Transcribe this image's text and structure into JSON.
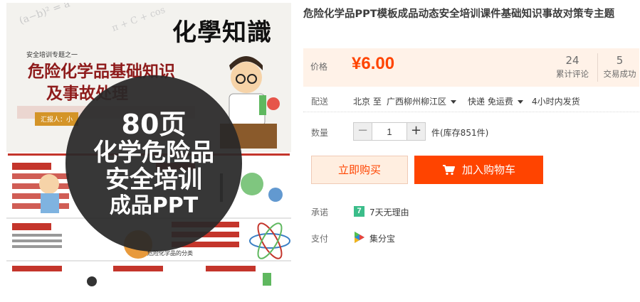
{
  "gallery": {
    "brand_title": "化學知識",
    "topic_sub": "安全培训专题之一",
    "topic_main_line1": "危险化学品基础知识",
    "topic_main_line2": "及事故处理",
    "reporter": "汇报人：小",
    "badge_line1": "80页",
    "badge_line2": "化学危险品",
    "badge_line3": "安全培训",
    "badge_line4": "成品PPT",
    "slide_heading": "危险化学品的分类"
  },
  "product": {
    "title": "危险化学品PPT模板成品动态安全培训课件基础知识事故对策专主题"
  },
  "price": {
    "label": "价格",
    "value": "¥6.00",
    "reviews_count": "24",
    "reviews_label": "累计评论",
    "deals_count": "5",
    "deals_label": "交易成功",
    "accent_color": "#ff4400"
  },
  "shipping": {
    "label": "配送",
    "origin": "北京 至",
    "destination": "广西柳州柳江区",
    "method": "快递 免运费",
    "dispatch": "4小时内发货"
  },
  "quantity": {
    "label": "数量",
    "minus": "−",
    "value": "1",
    "plus": "+",
    "stock": "件(库存851件)"
  },
  "actions": {
    "buy_now": "立即购买",
    "add_to_cart": "加入购物车"
  },
  "promise": {
    "label": "承诺",
    "icon_text": "7",
    "text": "7天无理由"
  },
  "payment": {
    "label": "支付",
    "text": "集分宝"
  }
}
